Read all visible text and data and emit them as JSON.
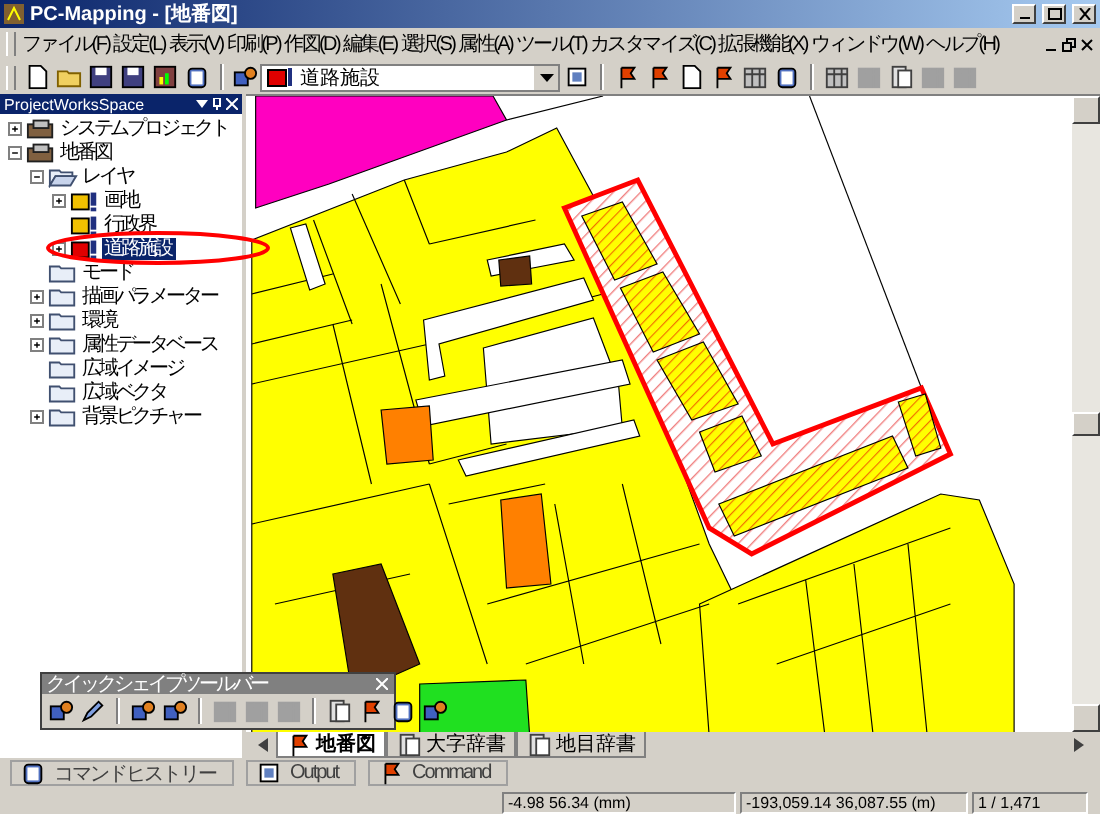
{
  "window": {
    "title": "PC-Mapping - [地番図]"
  },
  "menu": [
    "ファイル(F)",
    "設定(L)",
    "表示(V)",
    "印刷(P)",
    "作図(D)",
    "編集(E)",
    "選択(S)",
    "属性(A)",
    "ツール(T)",
    "カスタマイズ(C)",
    "拡張機能(X)",
    "ウィンドウ(W)",
    "ヘルプ(H)"
  ],
  "toolbar": {
    "file_buttons": [
      {
        "disabled": false
      },
      {
        "disabled": false
      },
      {
        "disabled": false
      },
      {
        "disabled": false
      },
      {
        "disabled": false
      },
      {
        "disabled": false
      }
    ],
    "layer_combo": {
      "value": "道路施設"
    },
    "layer_buttons": [
      {
        "disabled": false
      },
      {
        "disabled": false
      },
      {
        "disabled": false
      },
      {
        "disabled": false
      },
      {
        "disabled": false
      },
      {
        "disabled": false
      },
      {
        "disabled": false
      }
    ],
    "table_buttons": [
      {
        "disabled": false
      },
      {
        "disabled": true
      },
      {
        "disabled": false
      },
      {
        "disabled": true
      },
      {
        "disabled": true
      }
    ]
  },
  "workspace": {
    "title": "ProjectWorksSpace",
    "tree": [
      {
        "label": "システムプロジェクト",
        "kind": "project",
        "expanded": false,
        "selected": false
      },
      {
        "label": "地番図",
        "kind": "project",
        "expanded": true,
        "selected": false,
        "children": [
          {
            "label": "レイヤ",
            "kind": "folder-open",
            "expanded": true,
            "selected": false,
            "children": [
              {
                "label": "画地",
                "kind": "layer",
                "expanded": false,
                "selected": false,
                "color": "#f0c000"
              },
              {
                "label": "行政界",
                "kind": "layer",
                "selected": false,
                "color": "#f0c000"
              },
              {
                "label": "道路施設",
                "kind": "layer",
                "expanded": false,
                "selected": true,
                "color": "#e00000"
              }
            ]
          },
          {
            "label": "モード",
            "kind": "folder",
            "selected": false
          },
          {
            "label": "描画パラメーター",
            "kind": "folder",
            "expanded": false,
            "selected": false
          },
          {
            "label": "環境",
            "kind": "folder",
            "expanded": false,
            "selected": false
          },
          {
            "label": "属性データベース",
            "kind": "folder",
            "expanded": false,
            "selected": false
          },
          {
            "label": "広域イメージ",
            "kind": "folder",
            "selected": false
          },
          {
            "label": "広域ベクタ",
            "kind": "folder",
            "selected": false
          },
          {
            "label": "背景ピクチャー",
            "kind": "folder",
            "expanded": false,
            "selected": false
          }
        ]
      }
    ]
  },
  "map_tabs": [
    {
      "label": "地番図",
      "selected": true
    },
    {
      "label": "大字辞書",
      "selected": false
    },
    {
      "label": "地目辞書",
      "selected": false
    }
  ],
  "quick_shape_toolbar": {
    "title": "クイックシェイプツールバー",
    "buttons": [
      {
        "disabled": false
      },
      {
        "disabled": false
      },
      {
        "disabled": false
      },
      {
        "disabled": false
      },
      {
        "disabled": true
      },
      {
        "disabled": true
      },
      {
        "disabled": true
      },
      {
        "disabled": false
      },
      {
        "disabled": false
      },
      {
        "disabled": false
      },
      {
        "disabled": false
      }
    ]
  },
  "output_tabs": [
    {
      "label": "コマンドヒストリー",
      "selected": false
    },
    {
      "label": "Output",
      "selected": false
    },
    {
      "label": "Command",
      "selected": false
    }
  ],
  "status_bar": [
    "-4.98 56.34 (mm)",
    "-193,059.14 36,087.55 (m)",
    "1 / 1,471"
  ]
}
